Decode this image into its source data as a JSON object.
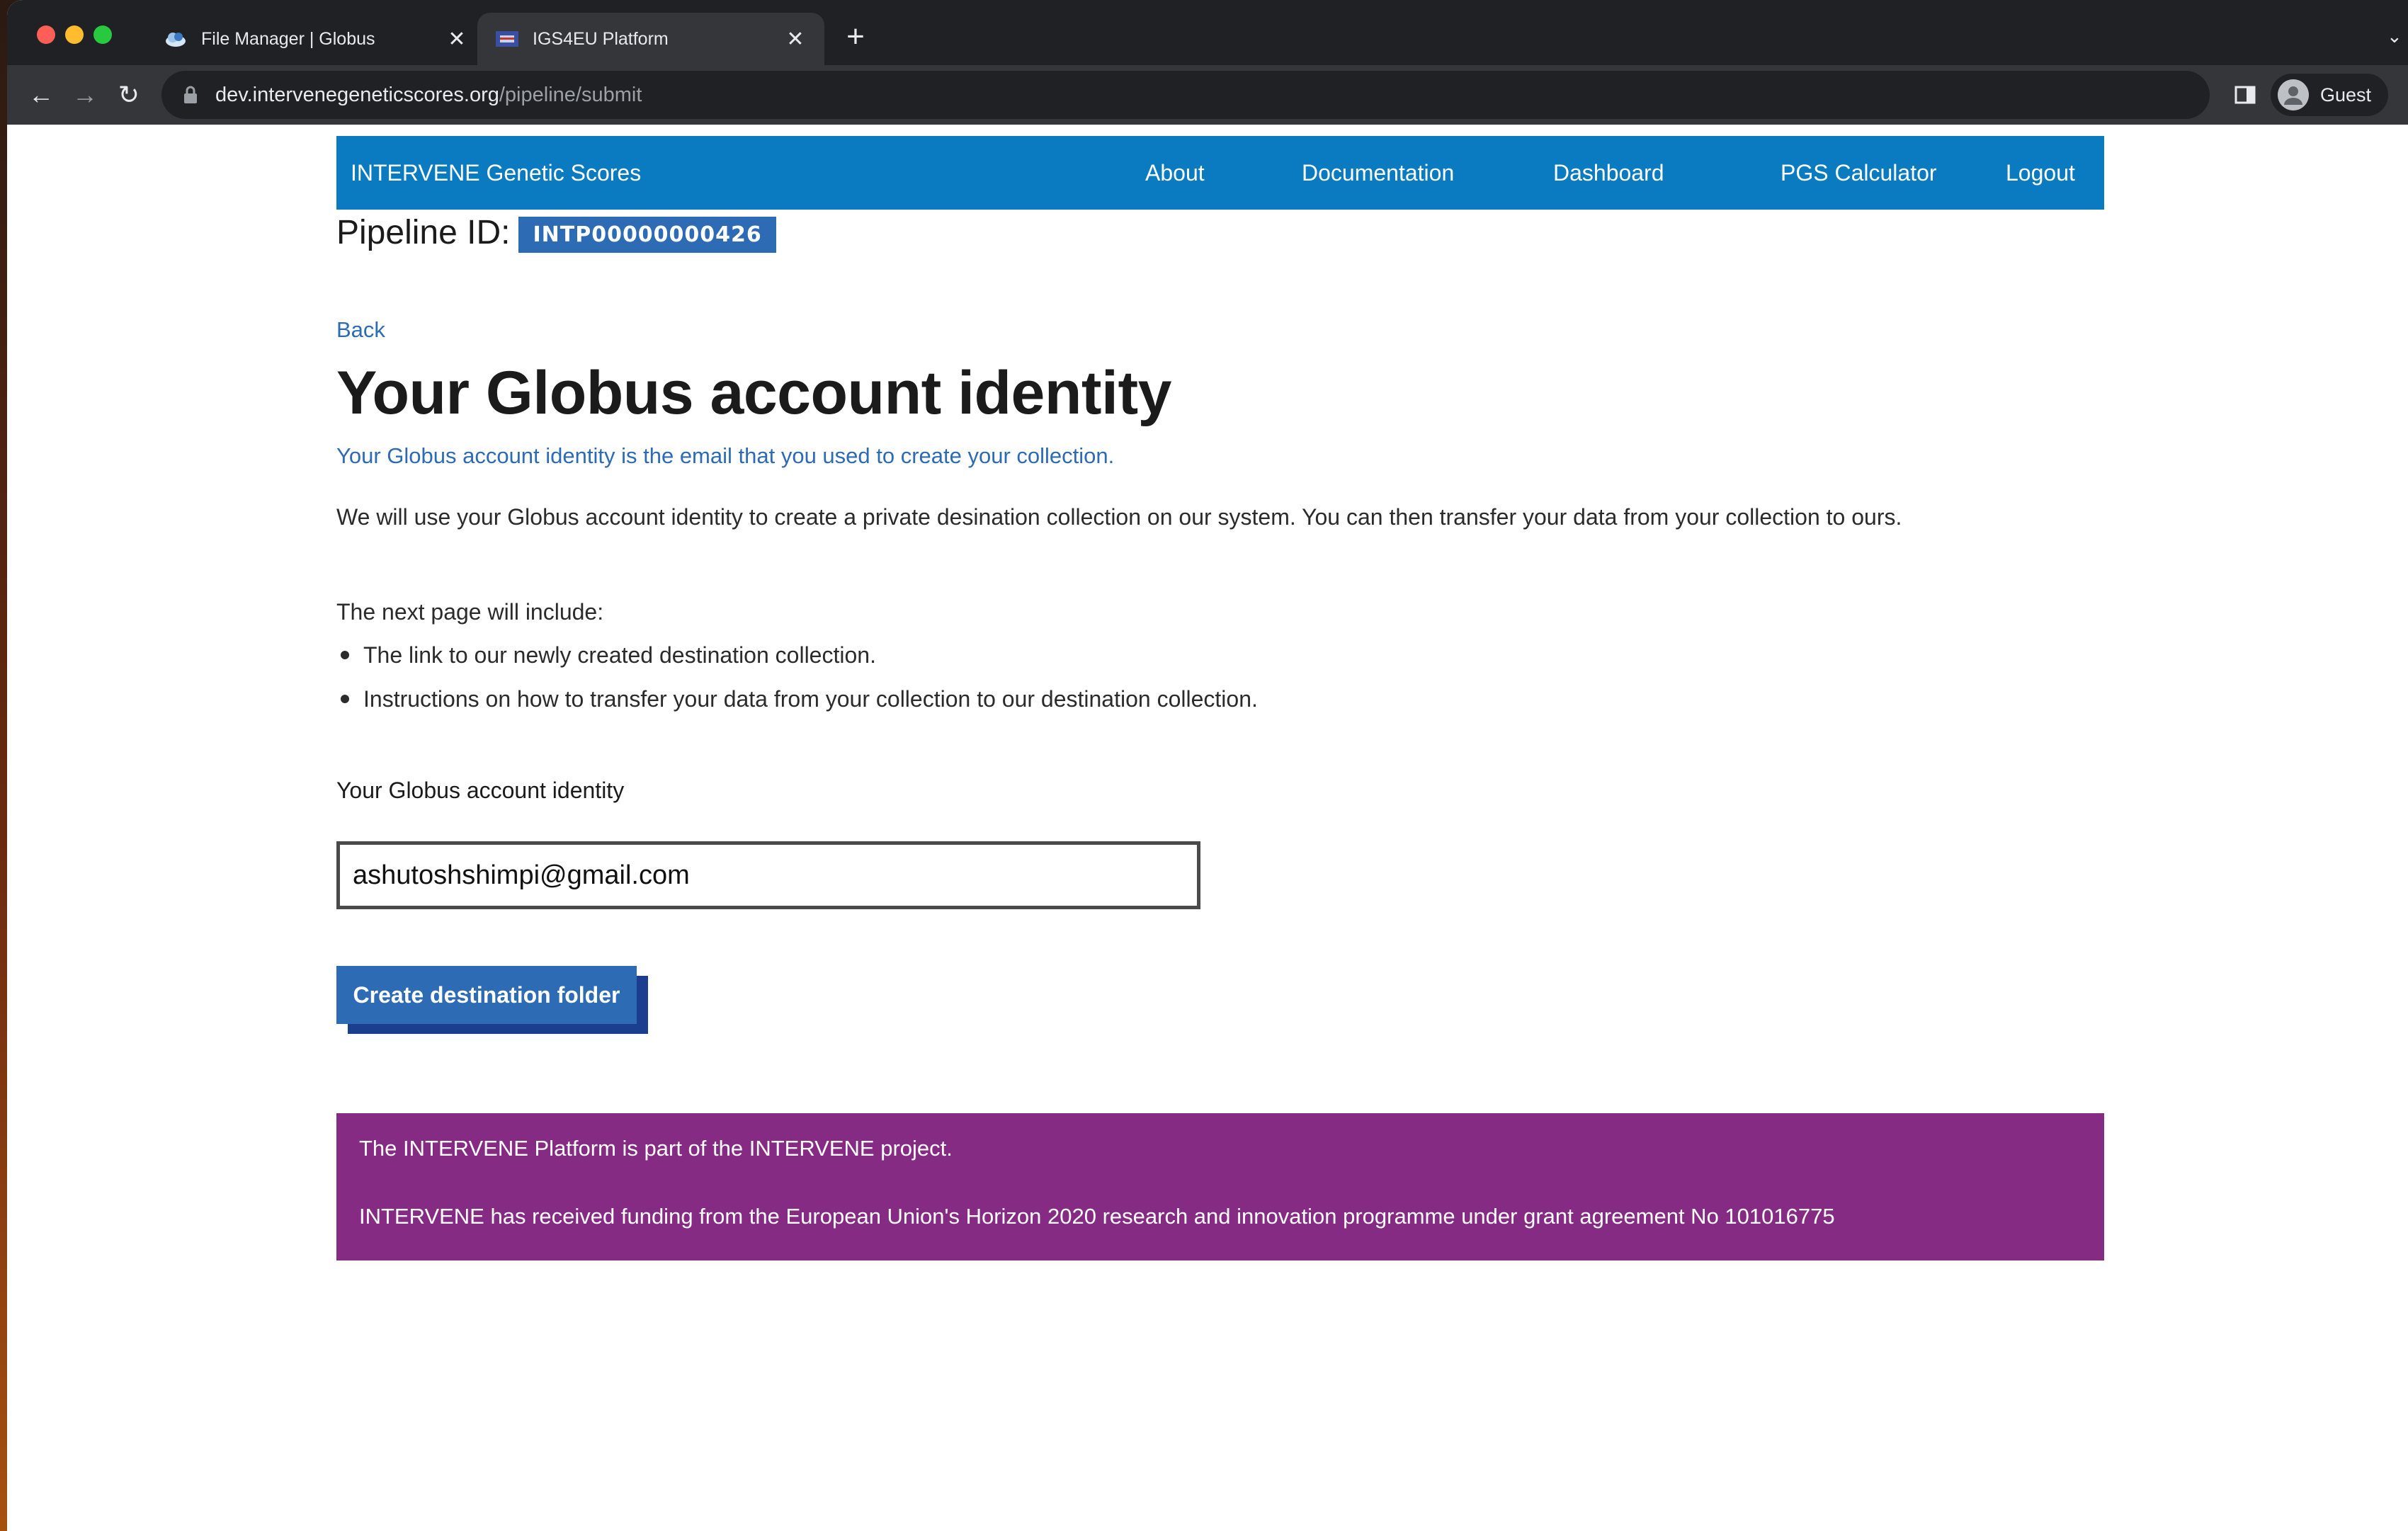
{
  "browser": {
    "tabs": [
      {
        "title": "File Manager | Globus",
        "favicon": "globus-cloud-icon",
        "active": false
      },
      {
        "title": "IGS4EU Platform",
        "favicon": "eu-flag-icon",
        "active": true
      }
    ],
    "url_host": "dev.intervenegeneticscores.org",
    "url_path": "/pipeline/submit",
    "profile_label": "Guest"
  },
  "header": {
    "brand": "INTERVENE Genetic Scores",
    "nav": [
      "About",
      "Documentation",
      "Dashboard",
      "PGS Calculator",
      "Logout"
    ],
    "color": "#0a7ac1"
  },
  "pipeline": {
    "label": "Pipeline ID:",
    "id": "INTP00000000426"
  },
  "main": {
    "back": "Back",
    "title": "Your Globus account identity",
    "subtitle": "Your Globus account identity is the email that you used to create your collection.",
    "description": "We will use your Globus account identity to create a private desination collection on our system. You can then transfer your data from your collection to ours.",
    "next_page_intro": "The next page will include:",
    "bullets": [
      "The link to our newly created destination collection.",
      "Instructions on how to transfer your data from your collection to our destination collection."
    ],
    "field_label": "Your Globus account identity",
    "field_value": "ashutoshshimpi@gmail.com",
    "submit_label": "Create destination folder",
    "accent_color": "#2d6bb5"
  },
  "footer": {
    "line1": "The INTERVENE Platform is part of the INTERVENE project.",
    "line2": "INTERVENE has received funding from the European Union's Horizon 2020 research and innovation programme under grant agreement No 101016775",
    "color": "#862b84"
  }
}
